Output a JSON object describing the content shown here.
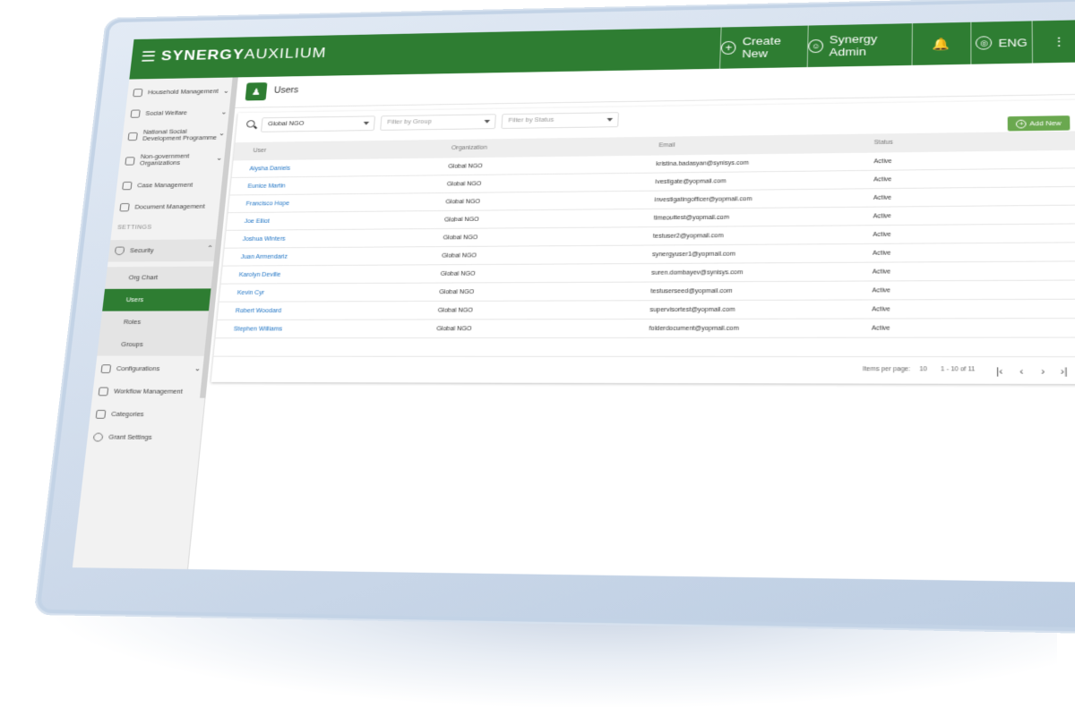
{
  "app": {
    "logo_bold": "SYNERGY",
    "logo_light": "AUXILIUM",
    "create_new": "Create New",
    "user_name": "Synergy Admin",
    "language": "ENG"
  },
  "sidebar": {
    "items_top": [
      {
        "label": "Household Management",
        "icon": "house-icon"
      },
      {
        "label": "Social Welfare",
        "icon": "handshake-icon"
      },
      {
        "label": "National Social Development Programme",
        "icon": "shield-leaf-icon"
      },
      {
        "label": "Non-government Organizations",
        "icon": "building-icon"
      },
      {
        "label": "Case Management",
        "icon": "scales-icon"
      },
      {
        "label": "Document Management",
        "icon": "document-icon"
      }
    ],
    "settings_heading": "SETTINGS",
    "security": {
      "label": "Security",
      "icon": "shield-icon"
    },
    "security_sub": [
      "Org Chart",
      "Users",
      "Roles",
      "Groups"
    ],
    "active_sub": "Users",
    "items_bottom": [
      {
        "label": "Configurations",
        "icon": "sliders-icon"
      },
      {
        "label": "Workflow Management",
        "icon": "briefcase-icon"
      },
      {
        "label": "Categories",
        "icon": "grid-icon"
      },
      {
        "label": "Grant Settings",
        "icon": "gear-icon"
      }
    ]
  },
  "page": {
    "title": "Users"
  },
  "filters": {
    "organization": "Global NGO",
    "group_placeholder": "Filter by Group",
    "status_placeholder": "Filter by Status"
  },
  "add_button": "Add New",
  "table": {
    "columns": [
      "User",
      "Organization",
      "Email",
      "Status"
    ],
    "rows": [
      {
        "user": "Alysha Daniels",
        "org": "Global NGO",
        "email": "kristina.badasyan@synisys.com",
        "status": "Active"
      },
      {
        "user": "Eunice Martin",
        "org": "Global NGO",
        "email": "ivestigate@yopmail.com",
        "status": "Active"
      },
      {
        "user": "Francisco Hope",
        "org": "Global NGO",
        "email": "investigatingofficer@yopmail.com",
        "status": "Active"
      },
      {
        "user": "Joe Elliot",
        "org": "Global NGO",
        "email": "timeouttest@yopmail.com",
        "status": "Active"
      },
      {
        "user": "Joshua Winters",
        "org": "Global NGO",
        "email": "testuser2@yopmail.com",
        "status": "Active"
      },
      {
        "user": "Juan Armendariz",
        "org": "Global NGO",
        "email": "synergyuser1@yopmail.com",
        "status": "Active"
      },
      {
        "user": "Karolyn Deville",
        "org": "Global NGO",
        "email": "suren.dombayev@synisys.com",
        "status": "Active"
      },
      {
        "user": "Kevin Cyr",
        "org": "Global NGO",
        "email": "testuserseed@yopmail.com",
        "status": "Active"
      },
      {
        "user": "Robert Woodard",
        "org": "Global NGO",
        "email": "supervisortest@yopmail.com",
        "status": "Active"
      },
      {
        "user": "Stephen Williams",
        "org": "Global NGO",
        "email": "folderdocument@yopmail.com",
        "status": "Active"
      }
    ]
  },
  "pagination": {
    "items_per_page_label": "Items per page:",
    "items_per_page": "10",
    "range": "1 - 10 of 11"
  },
  "colors": {
    "brand_green": "#2e7d32",
    "button_green": "#6aa84f",
    "link_blue": "#1e73c4"
  }
}
